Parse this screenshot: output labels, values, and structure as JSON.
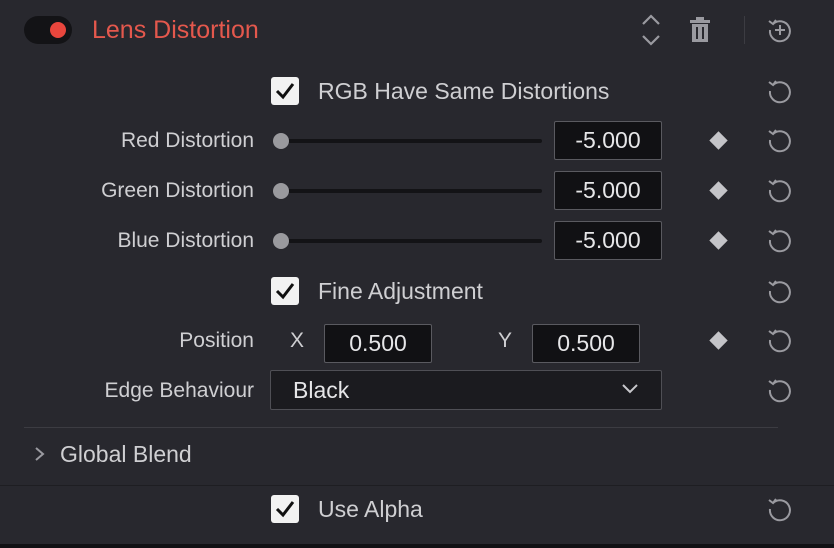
{
  "header": {
    "title": "Lens Distortion",
    "enabled": true,
    "accent_color": "#e8463d",
    "icons": [
      "expand-collapse-icon",
      "trash-icon",
      "reset-all-icon"
    ]
  },
  "controls": {
    "rgb_same": {
      "label": "RGB Have Same Distortions",
      "checked": true
    },
    "red": {
      "label": "Red Distortion",
      "value": "-5.000"
    },
    "green": {
      "label": "Green Distortion",
      "value": "-5.000"
    },
    "blue": {
      "label": "Blue Distortion",
      "value": "-5.000"
    },
    "fine": {
      "label": "Fine Adjustment",
      "checked": true
    },
    "position": {
      "label": "Position",
      "x_label": "X",
      "x_value": "0.500",
      "y_label": "Y",
      "y_value": "0.500"
    },
    "edge": {
      "label": "Edge Behaviour",
      "value": "Black"
    }
  },
  "global_blend": {
    "label": "Global Blend"
  },
  "use_alpha": {
    "label": "Use Alpha",
    "checked": true
  }
}
